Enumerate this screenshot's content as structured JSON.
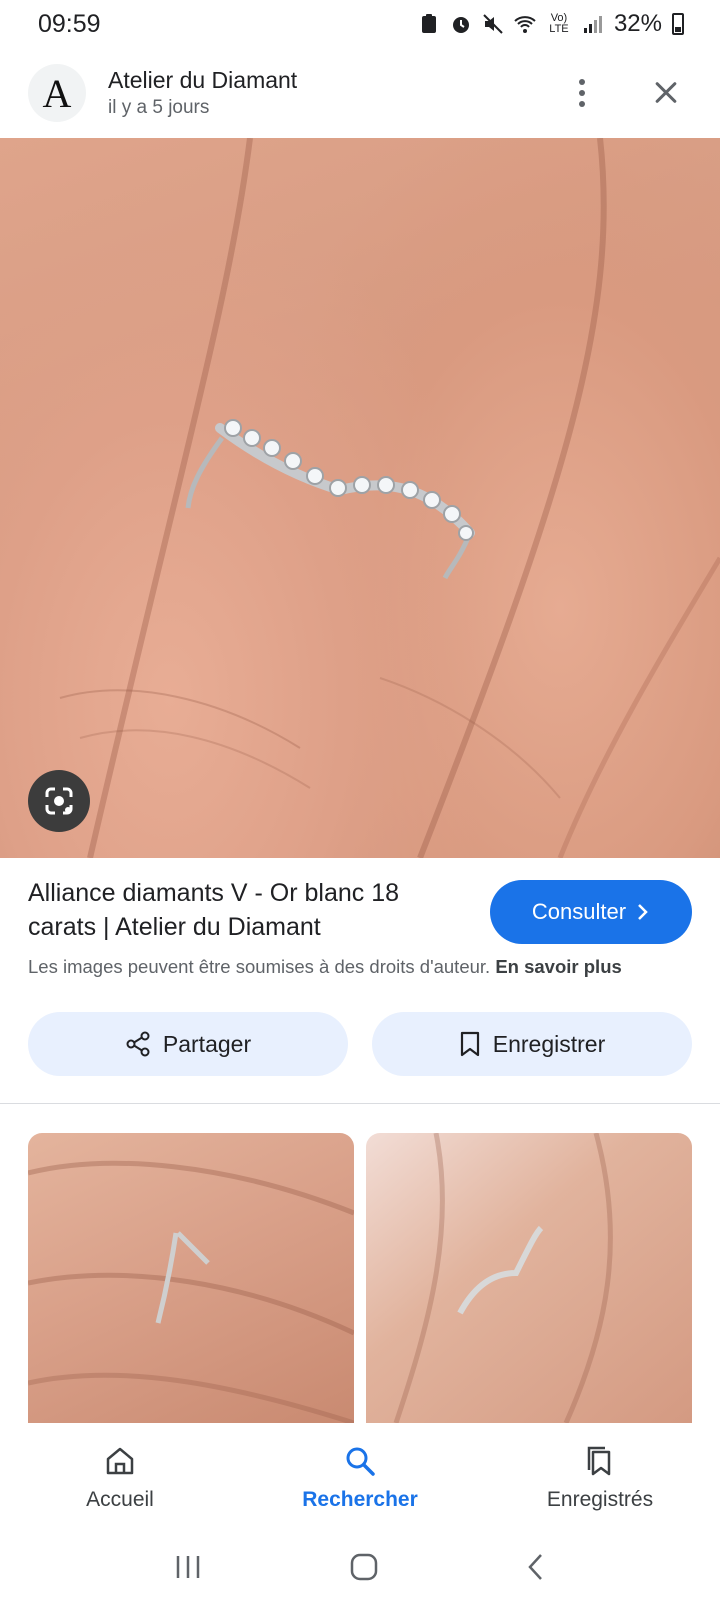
{
  "status_bar": {
    "time": "09:59",
    "battery": "32%",
    "network_label": "Vo) LTE"
  },
  "header": {
    "avatar_letter": "A",
    "site_name": "Atelier du Diamant",
    "posted": "il y a 5 jours"
  },
  "product": {
    "title": "Alliance diamants V - Or blanc 18 carats | Atelier du Diamant",
    "visit_label": "Consulter",
    "copyright_text": "Les images peuvent être soumises à des droits d'auteur.",
    "learn_more": "En savoir plus"
  },
  "actions": {
    "share_label": "Partager",
    "save_label": "Enregistrer"
  },
  "bottom_nav": {
    "home": "Accueil",
    "search": "Rechercher",
    "saved": "Enregistrés"
  },
  "colors": {
    "accent": "#1a73e8",
    "pill_bg": "#e8f0fe"
  }
}
